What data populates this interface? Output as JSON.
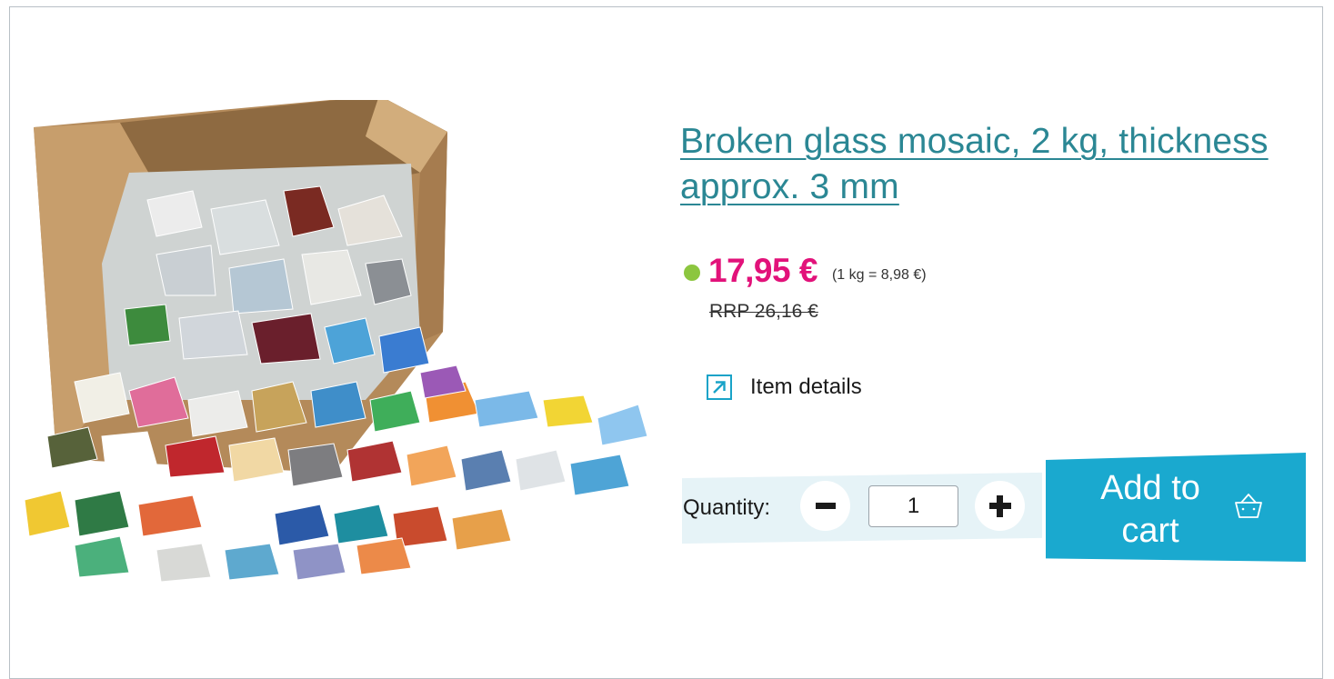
{
  "product": {
    "title": "Broken glass mosaic, 2 kg, thickness approx. 3 mm",
    "image_icon": "glass-mosaic-box-image",
    "price": "17,95 €",
    "unit_price": "(1 kg = 8,98 €)",
    "rrp": "RRP 26,16 €",
    "availability_color": "#8cc63f"
  },
  "details_link": {
    "label": "Item details",
    "icon": "external-link-icon"
  },
  "quantity": {
    "label": "Quantity:",
    "value": "1",
    "decrease_icon": "minus-icon",
    "increase_icon": "plus-icon"
  },
  "cart": {
    "label": "Add to cart",
    "icon": "basket-icon"
  },
  "colors": {
    "title": "#2b8794",
    "price": "#e2127a",
    "accent": "#1aa9cf",
    "quantity_background": "#e6f3f7"
  }
}
